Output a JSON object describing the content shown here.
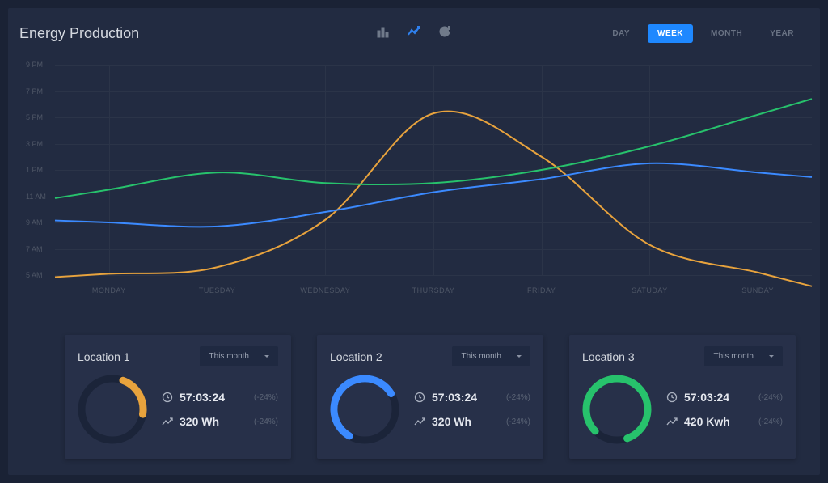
{
  "title": "Energy Production",
  "range_tabs": [
    "DAY",
    "WEEK",
    "MONTH",
    "YEAR"
  ],
  "active_range": "WEEK",
  "chart_icons": [
    "bar-chart-icon",
    "line-chart-icon",
    "refresh-icon"
  ],
  "active_chart_icon": "line-chart-icon",
  "colors": {
    "series_a": "#e8a33d",
    "series_b": "#3b8aff",
    "series_c": "#27c26c",
    "donut_track": "#1b2439"
  },
  "chart_data": {
    "type": "line",
    "title": "Energy Production",
    "xlabel": "",
    "ylabel": "",
    "x_ticks": [
      "MONDAY",
      "TUESDAY",
      "WEDNESDAY",
      "THURSDAY",
      "FRIDAY",
      "SATUDAY",
      "SUNDAY"
    ],
    "y_ticks": [
      "5 AM",
      "7 AM",
      "9 AM",
      "11 AM",
      "1 PM",
      "3 PM",
      "5 PM",
      "7 PM",
      "9 PM"
    ],
    "y_scale_hours": [
      5,
      7,
      9,
      11,
      13,
      15,
      17,
      19,
      21
    ],
    "ylim": [
      5,
      21
    ],
    "categories": [
      "MONDAY",
      "TUESDAY",
      "WEDNESDAY",
      "THURSDAY",
      "FRIDAY",
      "SATUDAY",
      "SUNDAY"
    ],
    "series": [
      {
        "name": "Location 1",
        "color": "#e8a33d",
        "values": [
          5.1,
          5.6,
          9.2,
          17.3,
          14.0,
          7.3,
          5.2
        ]
      },
      {
        "name": "Location 2",
        "color": "#3b8aff",
        "values": [
          9.0,
          8.7,
          9.8,
          11.3,
          12.3,
          13.5,
          12.8
        ]
      },
      {
        "name": "Location 3",
        "color": "#27c26c",
        "values": [
          11.5,
          12.8,
          12.0,
          12.0,
          13.0,
          14.8,
          17.2
        ]
      }
    ]
  },
  "cards": [
    {
      "title": "Location 1",
      "dropdown": "This month",
      "donut": {
        "percent": 22,
        "rotation_deg": -70,
        "color": "#e8a33d"
      },
      "time": "57:03:24",
      "time_delta": "(-24%)",
      "power": "320 Wh",
      "power_delta": "(-24%)"
    },
    {
      "title": "Location 2",
      "dropdown": "This month",
      "donut": {
        "percent": 58,
        "rotation_deg": 120,
        "color": "#3b8aff"
      },
      "time": "57:03:24",
      "time_delta": "(-24%)",
      "power": "320 Wh",
      "power_delta": "(-24%)"
    },
    {
      "title": "Location 3",
      "dropdown": "This month",
      "donut": {
        "percent": 82,
        "rotation_deg": 135,
        "color": "#27c26c"
      },
      "time": "57:03:24",
      "time_delta": "(-24%)",
      "power": "420 Kwh",
      "power_delta": "(-24%)"
    }
  ]
}
